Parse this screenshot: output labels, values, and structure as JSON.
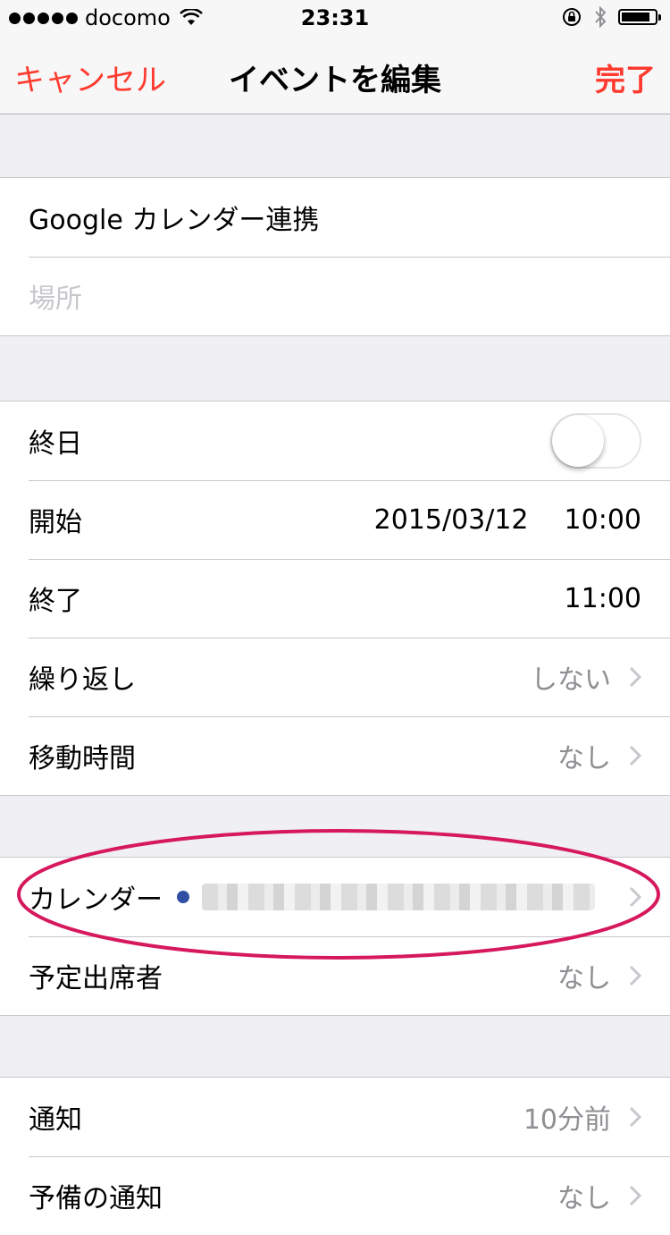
{
  "status_bar": {
    "carrier": "docomo",
    "time": "23:31",
    "battery_level": 0.85
  },
  "nav": {
    "cancel_label": "キャンセル",
    "title": "イベントを編集",
    "done_label": "完了"
  },
  "event": {
    "title": "Google カレンダー連携",
    "location_placeholder": "場所"
  },
  "schedule": {
    "all_day_label": "終日",
    "all_day_on": false,
    "start_label": "開始",
    "start_date": "2015/03/12",
    "start_time": "10:00",
    "end_label": "終了",
    "end_time": "11:00",
    "repeat_label": "繰り返し",
    "repeat_value": "しない",
    "travel_label": "移動時間",
    "travel_value": "なし"
  },
  "calendar": {
    "calendar_label": "カレンダー",
    "calendar_color": "#2e4fa3",
    "invitees_label": "予定出席者",
    "invitees_value": "なし"
  },
  "alerts": {
    "alert_label": "通知",
    "alert_value": "10分前",
    "second_alert_label": "予備の通知",
    "second_alert_value": "なし"
  },
  "colors": {
    "accent": "#ff3b30",
    "highlight": "#d6185c"
  }
}
